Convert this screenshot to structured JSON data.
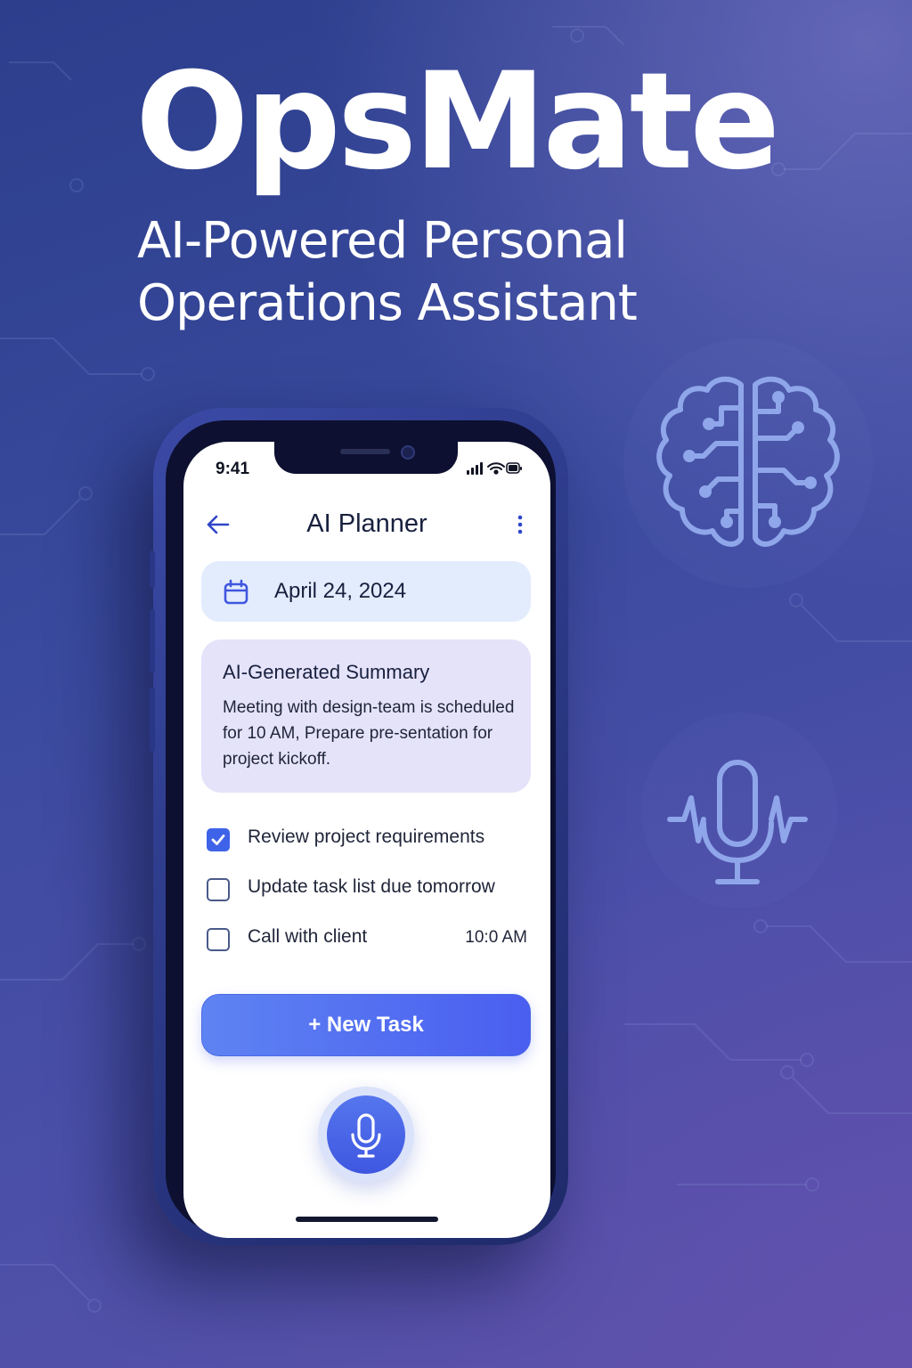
{
  "hero": {
    "title": "OpsMate",
    "subtitle_line1": "AI-Powered Personal",
    "subtitle_line2": "Operations Assistant"
  },
  "decor_icons": [
    "brain-circuit-icon",
    "microphone-waveform-icon"
  ],
  "colors": {
    "background_start": "#2c3e8c",
    "background_end": "#5a52a8",
    "accent": "#3f63e8",
    "decor_icon": "#8fa6ea",
    "date_card": "#e3ecfd",
    "summary_card": "#e5e3fa"
  },
  "status_bar": {
    "time": "9:41",
    "icons": [
      "signal-icon",
      "wifi-icon",
      "battery-icon"
    ]
  },
  "header": {
    "back_icon": "arrow-left-icon",
    "title": "AI Planner",
    "menu_icon": "more-vertical-icon"
  },
  "date_card": {
    "icon": "calendar-icon",
    "date": "April 24, 2024"
  },
  "summary": {
    "title": "AI-Generated Summary",
    "body": "Meeting with design-team is scheduled for 10 AM, Prepare pre-sentation for project kickoff."
  },
  "tasks": [
    {
      "label": "Review project requirements",
      "checked": true,
      "time": ""
    },
    {
      "label": "Update task list due tomorrow",
      "checked": false,
      "time": ""
    },
    {
      "label": "Call with client",
      "checked": false,
      "time": "10:0 AM"
    }
  ],
  "new_task_button": {
    "label": "+ New Task"
  },
  "voice_button": {
    "icon": "microphone-icon"
  }
}
